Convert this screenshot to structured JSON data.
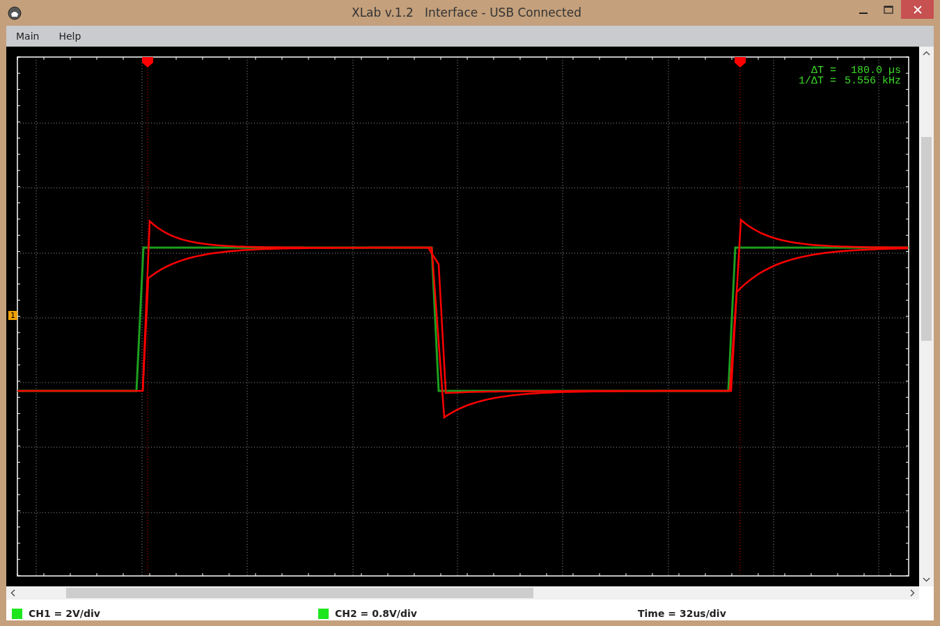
{
  "window": {
    "title": "XLab v.1.2   Interface - USB Connected"
  },
  "menu": [
    {
      "label": "Main"
    },
    {
      "label": "Help"
    }
  ],
  "scope": {
    "readout": [
      {
        "label": "ΔT =",
        "value": "180.0 µs"
      },
      {
        "label": "1/ΔT =",
        "value": "5.556 kHz"
      }
    ],
    "channel_marker": "1"
  },
  "status_bar": [
    {
      "kind": "channel",
      "text": "CH1 = 2V/div"
    },
    {
      "kind": "channel",
      "text": "CH2 = 0.8V/div"
    },
    {
      "kind": "time",
      "text": "Time = 32us/div"
    }
  ]
}
